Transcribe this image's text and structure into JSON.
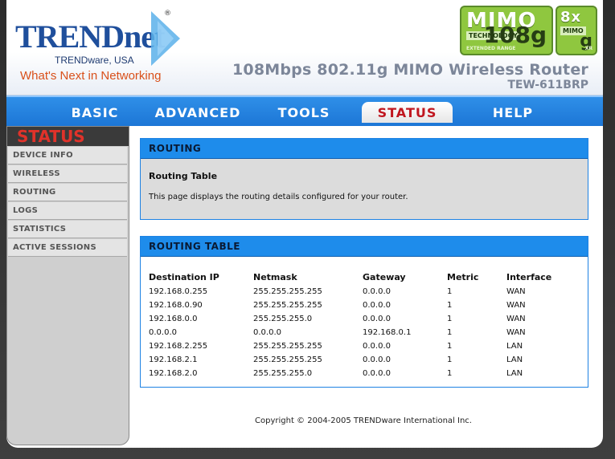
{
  "header": {
    "brand": "TRENDnet",
    "registered": "®",
    "sub_brand": "TRENDware, USA",
    "slogan": "What's Next in Networking",
    "product": "108Mbps 802.11g MIMO Wireless Router",
    "model": "TEW-611BRP",
    "badge1": {
      "big": "MIMO",
      "small": "TECHNOLOGY",
      "num": "108g",
      "ext": "EXTENDED RANGE"
    },
    "badge2": {
      "big": "8x",
      "small": "MIMO",
      "num": "g",
      "ext": "XR"
    }
  },
  "nav": {
    "items": [
      "BASIC",
      "ADVANCED",
      "TOOLS",
      "STATUS",
      "HELP"
    ],
    "active": "STATUS"
  },
  "sidebar": {
    "title": "STATUS",
    "items": [
      "DEVICE INFO",
      "WIRELESS",
      "ROUTING",
      "LOGS",
      "STATISTICS",
      "ACTIVE SESSIONS"
    ]
  },
  "routing_panel": {
    "header": "ROUTING",
    "title": "Routing Table",
    "description": "This page displays the routing details configured for your router."
  },
  "routing_table": {
    "header": "ROUTING TABLE",
    "columns": [
      "Destination IP",
      "Netmask",
      "Gateway",
      "Metric",
      "Interface"
    ],
    "rows": [
      [
        "192.168.0.255",
        "255.255.255.255",
        "0.0.0.0",
        "1",
        "WAN"
      ],
      [
        "192.168.0.90",
        "255.255.255.255",
        "0.0.0.0",
        "1",
        "WAN"
      ],
      [
        "192.168.0.0",
        "255.255.255.0",
        "0.0.0.0",
        "1",
        "WAN"
      ],
      [
        "0.0.0.0",
        "0.0.0.0",
        "192.168.0.1",
        "1",
        "WAN"
      ],
      [
        "192.168.2.255",
        "255.255.255.255",
        "0.0.0.0",
        "1",
        "LAN"
      ],
      [
        "192.168.2.1",
        "255.255.255.255",
        "0.0.0.0",
        "1",
        "LAN"
      ],
      [
        "192.168.2.0",
        "255.255.255.0",
        "0.0.0.0",
        "1",
        "LAN"
      ]
    ]
  },
  "footer": {
    "copyright": "Copyright © 2004-2005 TRENDware International Inc."
  },
  "colors": {
    "nav_blue": "#1e8ceb",
    "active_tab_text": "#c0161f",
    "slogan_orange": "#d9501a",
    "brand_blue": "#1f4f9c",
    "badge_green": "#8fc73f"
  }
}
